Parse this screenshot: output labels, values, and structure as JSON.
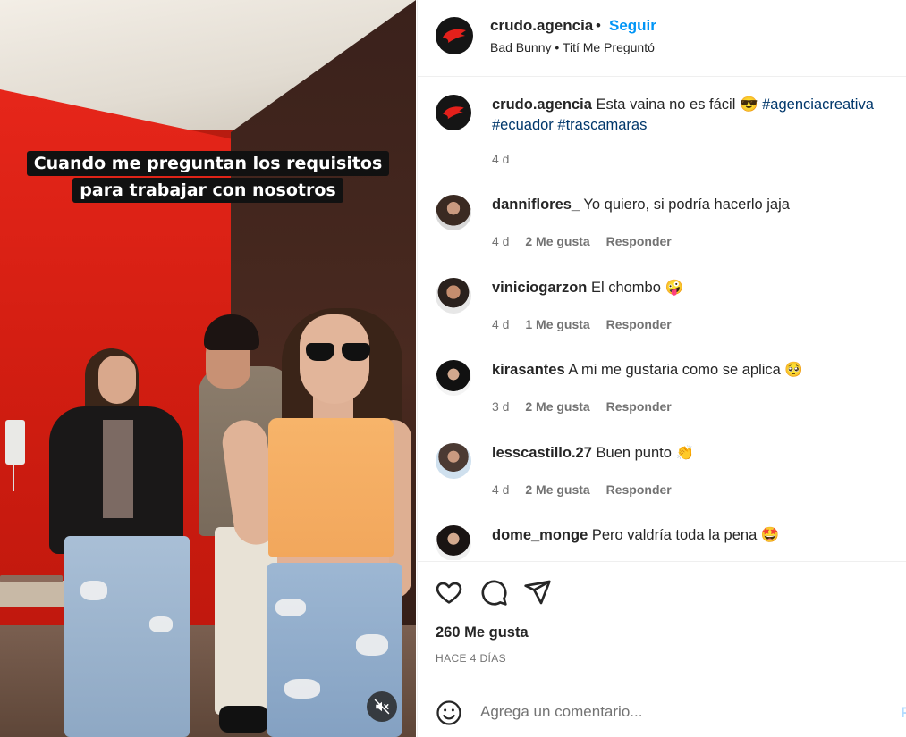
{
  "video": {
    "caption_line1": "Cuando me preguntan los requisitos",
    "caption_line2": "para trabajar con nosotros",
    "mute_icon": "speaker-muted-icon"
  },
  "header": {
    "username": "crudo.agencia",
    "separator": "•",
    "follow_label": "Seguir",
    "audio": "Bad Bunny • Tití Me Preguntó"
  },
  "post_caption": {
    "username": "crudo.agencia",
    "text": "Esta vaina no es fácil 😎",
    "hashtag1": "#agenciacreativa",
    "hashtag2": "#ecuador",
    "hashtag3": "#trascamaras",
    "time": "4 d"
  },
  "comments": [
    {
      "username": "danniflores_",
      "text": "Yo quiero, si podría hacerlo jaja",
      "time": "4 d",
      "likes": "2 Me gusta",
      "reply": "Responder"
    },
    {
      "username": "viniciogarzon",
      "text": "El chombo 🤪",
      "time": "4 d",
      "likes": "1 Me gusta",
      "reply": "Responder"
    },
    {
      "username": "kirasantes",
      "text": "A mi me gustaria como se aplica 🥺",
      "time": "3 d",
      "likes": "2 Me gusta",
      "reply": "Responder"
    },
    {
      "username": "lesscastillo.27",
      "text": "Buen punto 👏",
      "time": "4 d",
      "likes": "2 Me gusta",
      "reply": "Responder"
    },
    {
      "username": "dome_monge",
      "text": "Pero valdría toda la pena 🤩"
    }
  ],
  "actions": {
    "like_icon": "heart-icon",
    "comment_icon": "comment-icon",
    "share_icon": "share-icon",
    "likes": "260 Me gusta",
    "time": "HACE 4 DÍAS"
  },
  "add_comment": {
    "emoji_icon": "emoji-icon",
    "placeholder": "Agrega un comentario...",
    "publish": "P"
  },
  "colors": {
    "accent": "#0095f6",
    "hashtag": "#00376b",
    "muted_text": "#737373"
  }
}
